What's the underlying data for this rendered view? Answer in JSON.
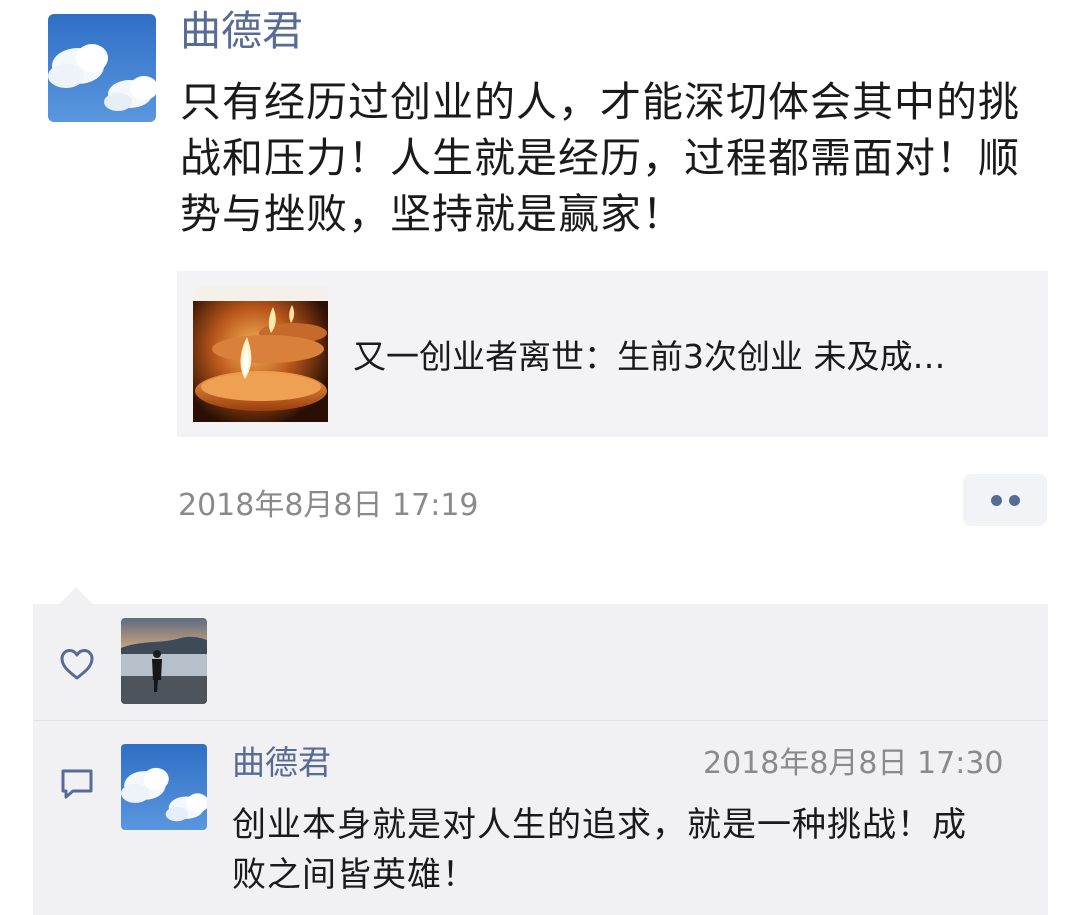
{
  "post": {
    "author": "曲德君",
    "avatar_icon": "sky-clouds-avatar",
    "text": "只有经历过创业的人，才能深切体会其中的挑战和压力！人生就是经历，过程都需面对！顺势与挫败，坚持就是赢家！",
    "link_card": {
      "thumbnail_icon": "candle-image",
      "title": "又一创业者离世：生前3次创业 未及成…"
    },
    "time": "2018年8月8日 17:19",
    "more_icon": "more-dots-icon"
  },
  "interactions": {
    "likes": {
      "icon": "heart-icon",
      "liker_avatar_icon": "person-at-beach-avatar"
    },
    "comments": [
      {
        "icon": "comment-icon",
        "author": "曲德君",
        "time": "2018年8月8日 17:30",
        "text": "创业本身就是对人生的追求，就是一种挑战！成败之间皆英雄！"
      }
    ]
  },
  "colors": {
    "name_link": "#576b95",
    "text": "#1a1a1a",
    "meta": "#8a8a8a",
    "panel_bg": "#f1f1f3",
    "card_bg": "#f3f3f5"
  }
}
